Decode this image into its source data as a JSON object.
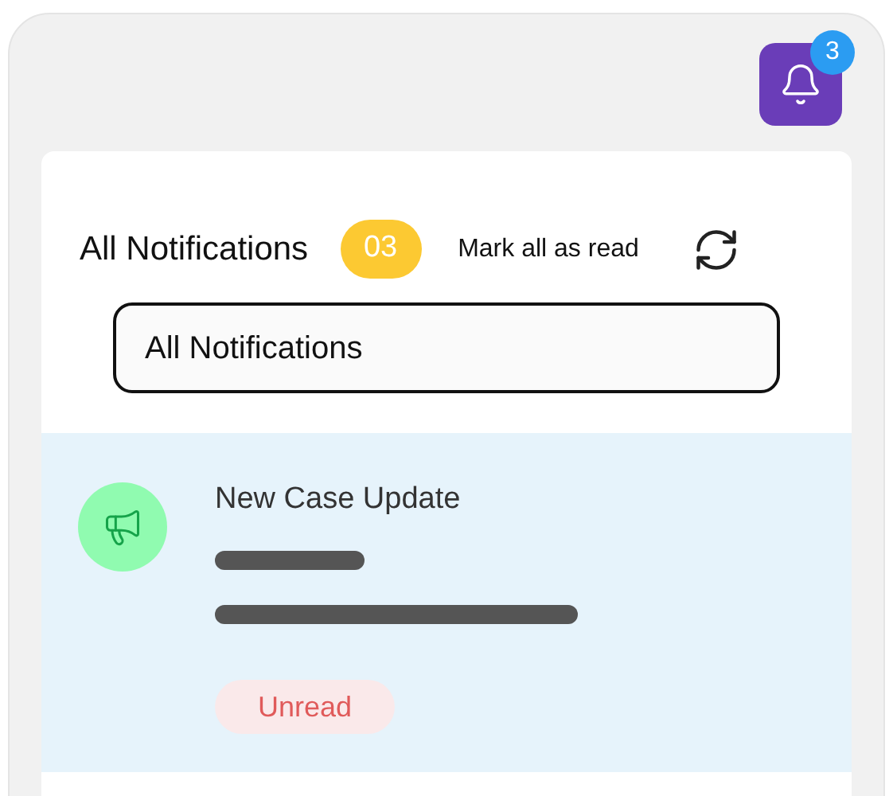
{
  "bell": {
    "badge": "3"
  },
  "header": {
    "title": "All Notifications",
    "count": "03",
    "mark_all": "Mark all as read"
  },
  "filter": {
    "value": "All Notifications"
  },
  "notifications": [
    {
      "title": "New Case Update",
      "unread": true,
      "status": "Unread"
    }
  ]
}
